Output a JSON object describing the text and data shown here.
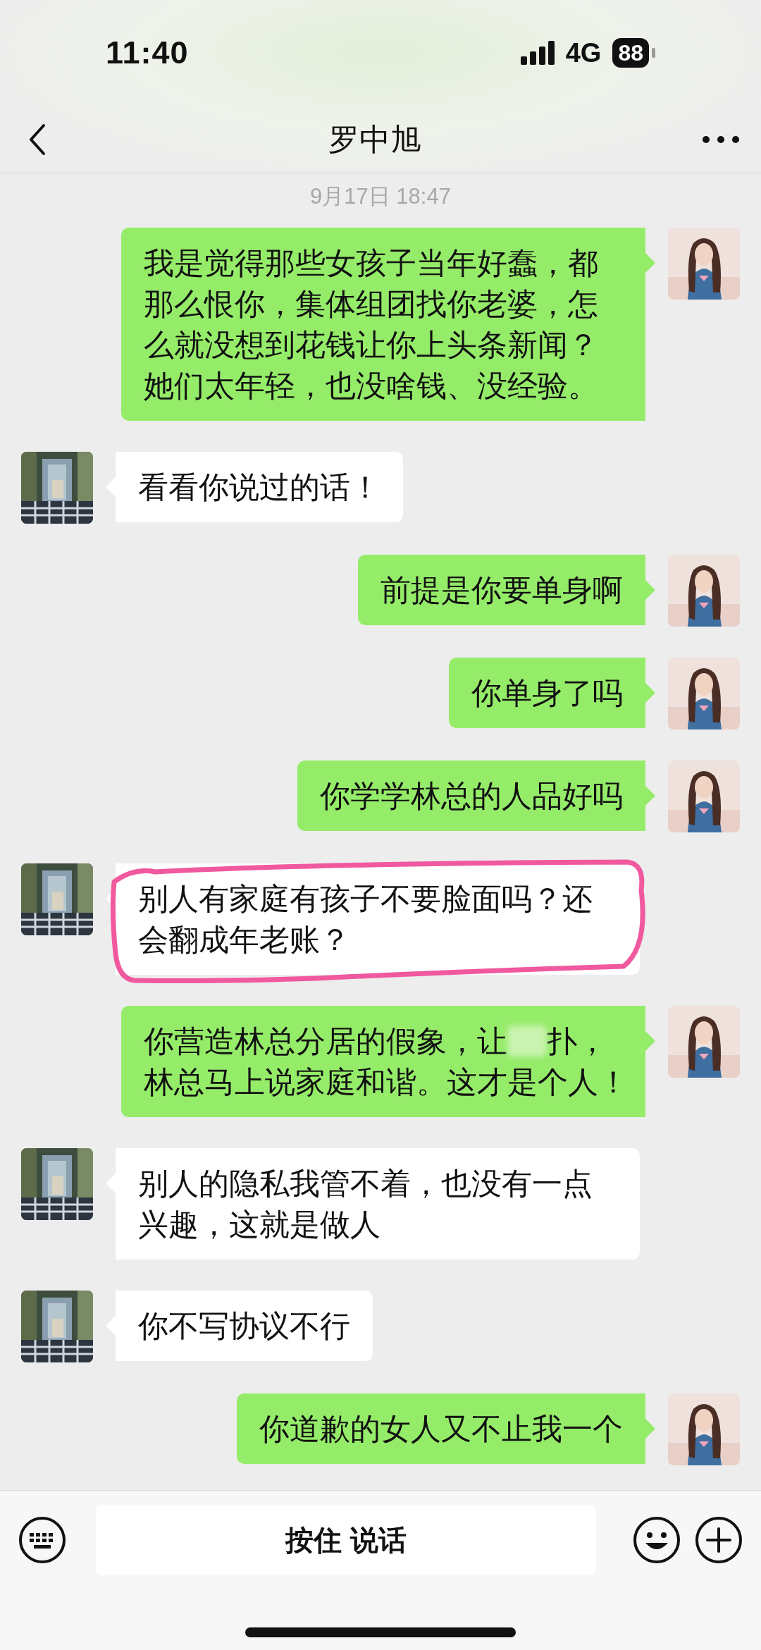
{
  "status_bar": {
    "time": "11:40",
    "network": "4G",
    "battery": "88"
  },
  "header": {
    "title": "罗中旭"
  },
  "timestamp": "9月17日 18:47",
  "messages": [
    {
      "kind": "outgoing",
      "highlighted": false,
      "text": "我是觉得那些女孩子当年好蠢，都那么恨你，集体组团找你老婆，怎么就没想到花钱让你上头条新闻？她们太年轻，也没啥钱、没经验。"
    },
    {
      "kind": "incoming",
      "highlighted": false,
      "text": "看看你说过的话！"
    },
    {
      "kind": "outgoing",
      "highlighted": false,
      "text": "前提是你要单身啊"
    },
    {
      "kind": "outgoing",
      "highlighted": false,
      "text": "你单身了吗"
    },
    {
      "kind": "outgoing",
      "highlighted": false,
      "text": "你学学林总的人品好吗"
    },
    {
      "kind": "incoming",
      "highlighted": true,
      "text": "别人有家庭有孩子不要脸面吗？还会翻成年老账？"
    },
    {
      "kind": "outgoing",
      "highlighted": false,
      "lines": [
        [
          {
            "kind": "text",
            "text": "你营造林总分居的假象，让"
          },
          {
            "kind": "redacted"
          },
          {
            "kind": "text",
            "text": "扑，"
          }
        ],
        [
          {
            "kind": "text",
            "text": "林总马上说家庭和谐。这才是个人！"
          }
        ]
      ]
    },
    {
      "kind": "incoming",
      "highlighted": false,
      "text": "别人的隐私我管不着，也没有一点兴趣，这就是做人"
    },
    {
      "kind": "incoming",
      "highlighted": false,
      "text": "你不写协议不行"
    },
    {
      "kind": "outgoing",
      "highlighted": false,
      "text": "你道歉的女人又不止我一个"
    }
  ],
  "input_bar": {
    "voice_button": "按住 说话"
  }
}
